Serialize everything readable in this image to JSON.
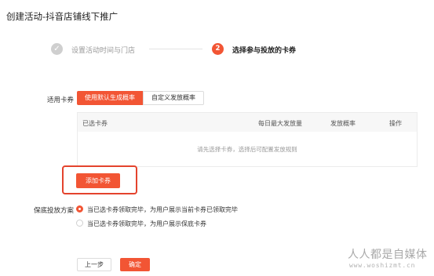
{
  "page": {
    "title": "创建活动-抖音店铺线下推广"
  },
  "steps": [
    {
      "index": "✓",
      "label": "设置活动时间与门店",
      "state": "done"
    },
    {
      "index": "2",
      "label": "选择参与投放的卡券",
      "state": "active"
    }
  ],
  "coupon_type": {
    "label": "适用卡券",
    "options": [
      "使用默认生成概率",
      "自定义发放概率"
    ],
    "selected": "使用默认生成概率"
  },
  "table": {
    "headers": [
      "已选卡券",
      "每日最大发放量",
      "发放概率",
      "操作"
    ],
    "empty_text": "请先选择卡券，选择后可配置发放规则"
  },
  "add_coupon_button": "添加卡券",
  "fallback_plan": {
    "label": "保底投放方案",
    "options": [
      "当已选卡券领取完毕，为用户展示当前卡券已领取完毕",
      "当已选卡券领取完毕，为用户展示保底卡券"
    ],
    "selected_index": 0
  },
  "footer": {
    "prev_label": "上一步",
    "confirm_label": "确定"
  },
  "watermark": {
    "main": "人人都是自媒体",
    "sub": "www.woshizmt.cn"
  },
  "colors": {
    "accent": "#f25534",
    "highlight_border": "#e4432d",
    "done_step": "#cfcfcf"
  }
}
